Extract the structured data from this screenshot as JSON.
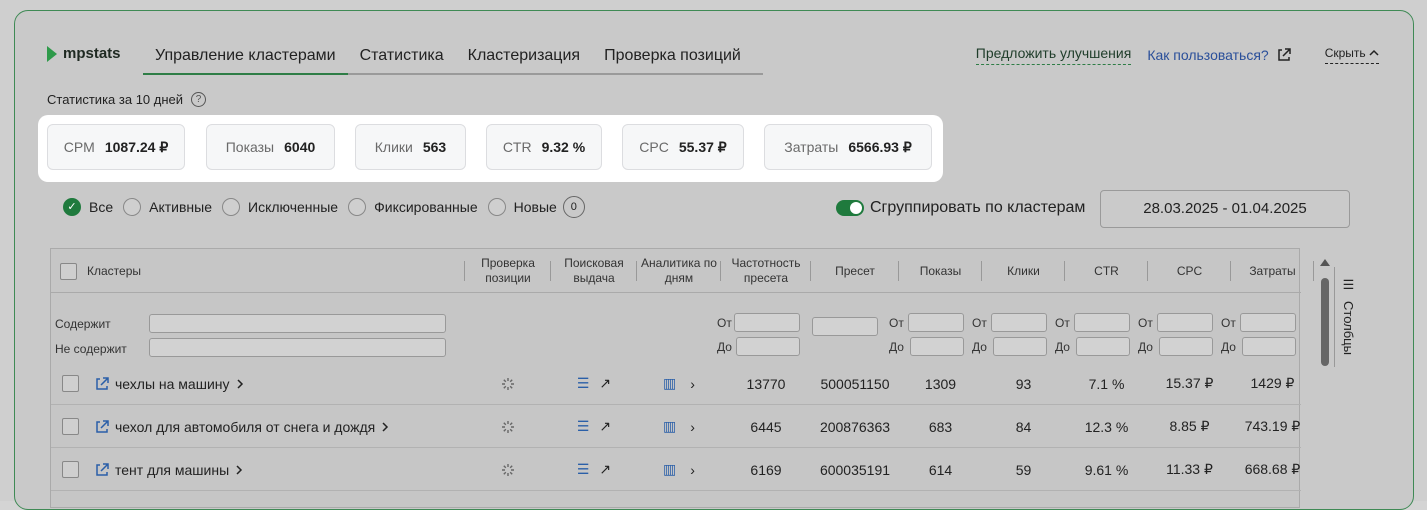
{
  "header": {
    "logo": "mpstats",
    "tabs": [
      {
        "label": "Управление кластерами",
        "active": true
      },
      {
        "label": "Статистика"
      },
      {
        "label": "Кластеризация"
      },
      {
        "label": "Проверка позиций"
      }
    ],
    "suggest_label": "Предложить улучшения",
    "howto_label": "Как пользоваться?",
    "hide_label": "Скрыть"
  },
  "stats": {
    "title": "Статистика за 10 дней",
    "items": [
      {
        "label": "CPM",
        "value": "1087.24 ₽"
      },
      {
        "label": "Показы",
        "value": "6040"
      },
      {
        "label": "Клики",
        "value": "563"
      },
      {
        "label": "CTR",
        "value": "9.32 %"
      },
      {
        "label": "CPC",
        "value": "55.37 ₽"
      },
      {
        "label": "Затраты",
        "value": "6566.93 ₽"
      }
    ]
  },
  "filters": {
    "options": [
      "Все",
      "Активные",
      "Исключенные",
      "Фиксированные",
      "Новые"
    ],
    "new_count": "0",
    "group_label": "Сгруппировать по кластерам",
    "date_range": "28.03.2025 - 01.04.2025"
  },
  "table": {
    "headers": {
      "clusters": "Кластеры",
      "check_pos": "Проверка позиции",
      "search": "Поисковая выдача",
      "analytics": "Аналитика по дням",
      "freq": "Частотность пресета",
      "preset": "Пресет",
      "shows": "Показы",
      "clicks": "Клики",
      "ctr": "CTR",
      "cpc": "CPC",
      "cost": "Затраты"
    },
    "filter_labels": {
      "contains": "Содержит",
      "not_contains": "Не содержит",
      "from": "От",
      "to": "До"
    },
    "rows": [
      {
        "keyword": "чехлы на машину",
        "freq": "13770",
        "preset": "500051150",
        "shows": "1309",
        "clicks": "93",
        "ctr": "7.1 %",
        "cpc": "15.37 ₽",
        "cost": "1429 ₽"
      },
      {
        "keyword": "чехол для автомобиля от снега и дождя",
        "freq": "6445",
        "preset": "200876363",
        "shows": "683",
        "clicks": "84",
        "ctr": "12.3 %",
        "cpc": "8.85 ₽",
        "cost": "743.19 ₽"
      },
      {
        "keyword": "тент для машины",
        "freq": "6169",
        "preset": "600035191",
        "shows": "614",
        "clicks": "59",
        "ctr": "9.61 %",
        "cpc": "11.33 ₽",
        "cost": "668.68 ₽"
      }
    ],
    "columns_button": "Столбцы"
  }
}
